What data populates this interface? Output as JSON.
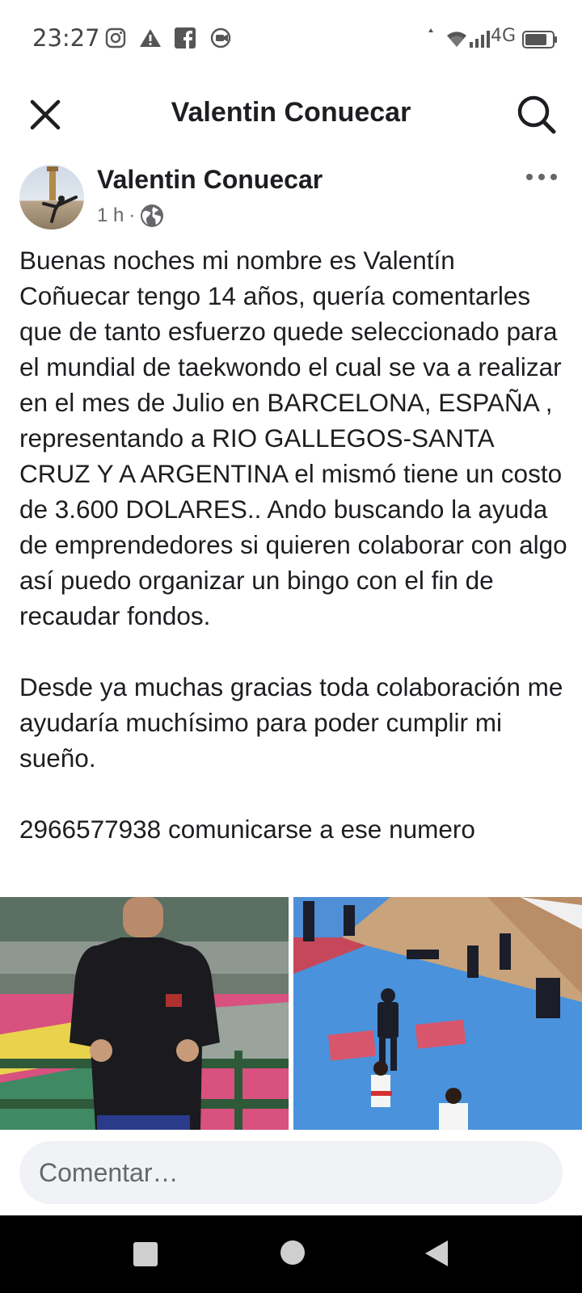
{
  "status_bar": {
    "time": "23:27",
    "left_icons": [
      "instagram-icon",
      "warning-icon",
      "facebook-icon",
      "media-icon"
    ],
    "network": "4G",
    "right_icons": [
      "data-arrows-icon",
      "wifi-icon",
      "signal-icon",
      "battery-icon"
    ]
  },
  "header": {
    "title": "Valentin Conuecar",
    "close_icon": "close-icon",
    "search_icon": "search-icon"
  },
  "post": {
    "author": "Valentin Conuecar",
    "time": "1 h",
    "separator": "·",
    "audience_icon": "globe-icon",
    "text": "Buenas noches mi nombre es Valentín Coñuecar tengo 14 años, quería comentarles que de tanto esfuerzo quede seleccionado para el mundial de taekwondo el cual se va a realizar en el mes de Julio en BARCELONA, ESPAÑA , representando a RIO GALLEGOS-SANTA CRUZ Y A ARGENTINA el mismó tiene un costo de 3.600 DOLARES.. Ando buscando la ayuda de emprendedores si quieren colaborar con algo así puedo organizar un bingo con el fin de recaudar fondos.\n\nDesde ya muchas gracias toda colaboración me ayudaría muchísimo para poder cumplir mi sueño.\n\n2966577938 comunicarse a ese numero",
    "photos": [
      "photo-athlete-portrait",
      "photo-taekwondo-match"
    ]
  },
  "comment": {
    "placeholder": "Comentar…"
  },
  "nav": {
    "icons": [
      "recents-icon",
      "home-icon",
      "back-icon"
    ]
  },
  "colors": {
    "text": "#1c1e21",
    "secondary_text": "#65676b",
    "input_bg": "#f0f2f5",
    "nav_bg": "#000000"
  }
}
